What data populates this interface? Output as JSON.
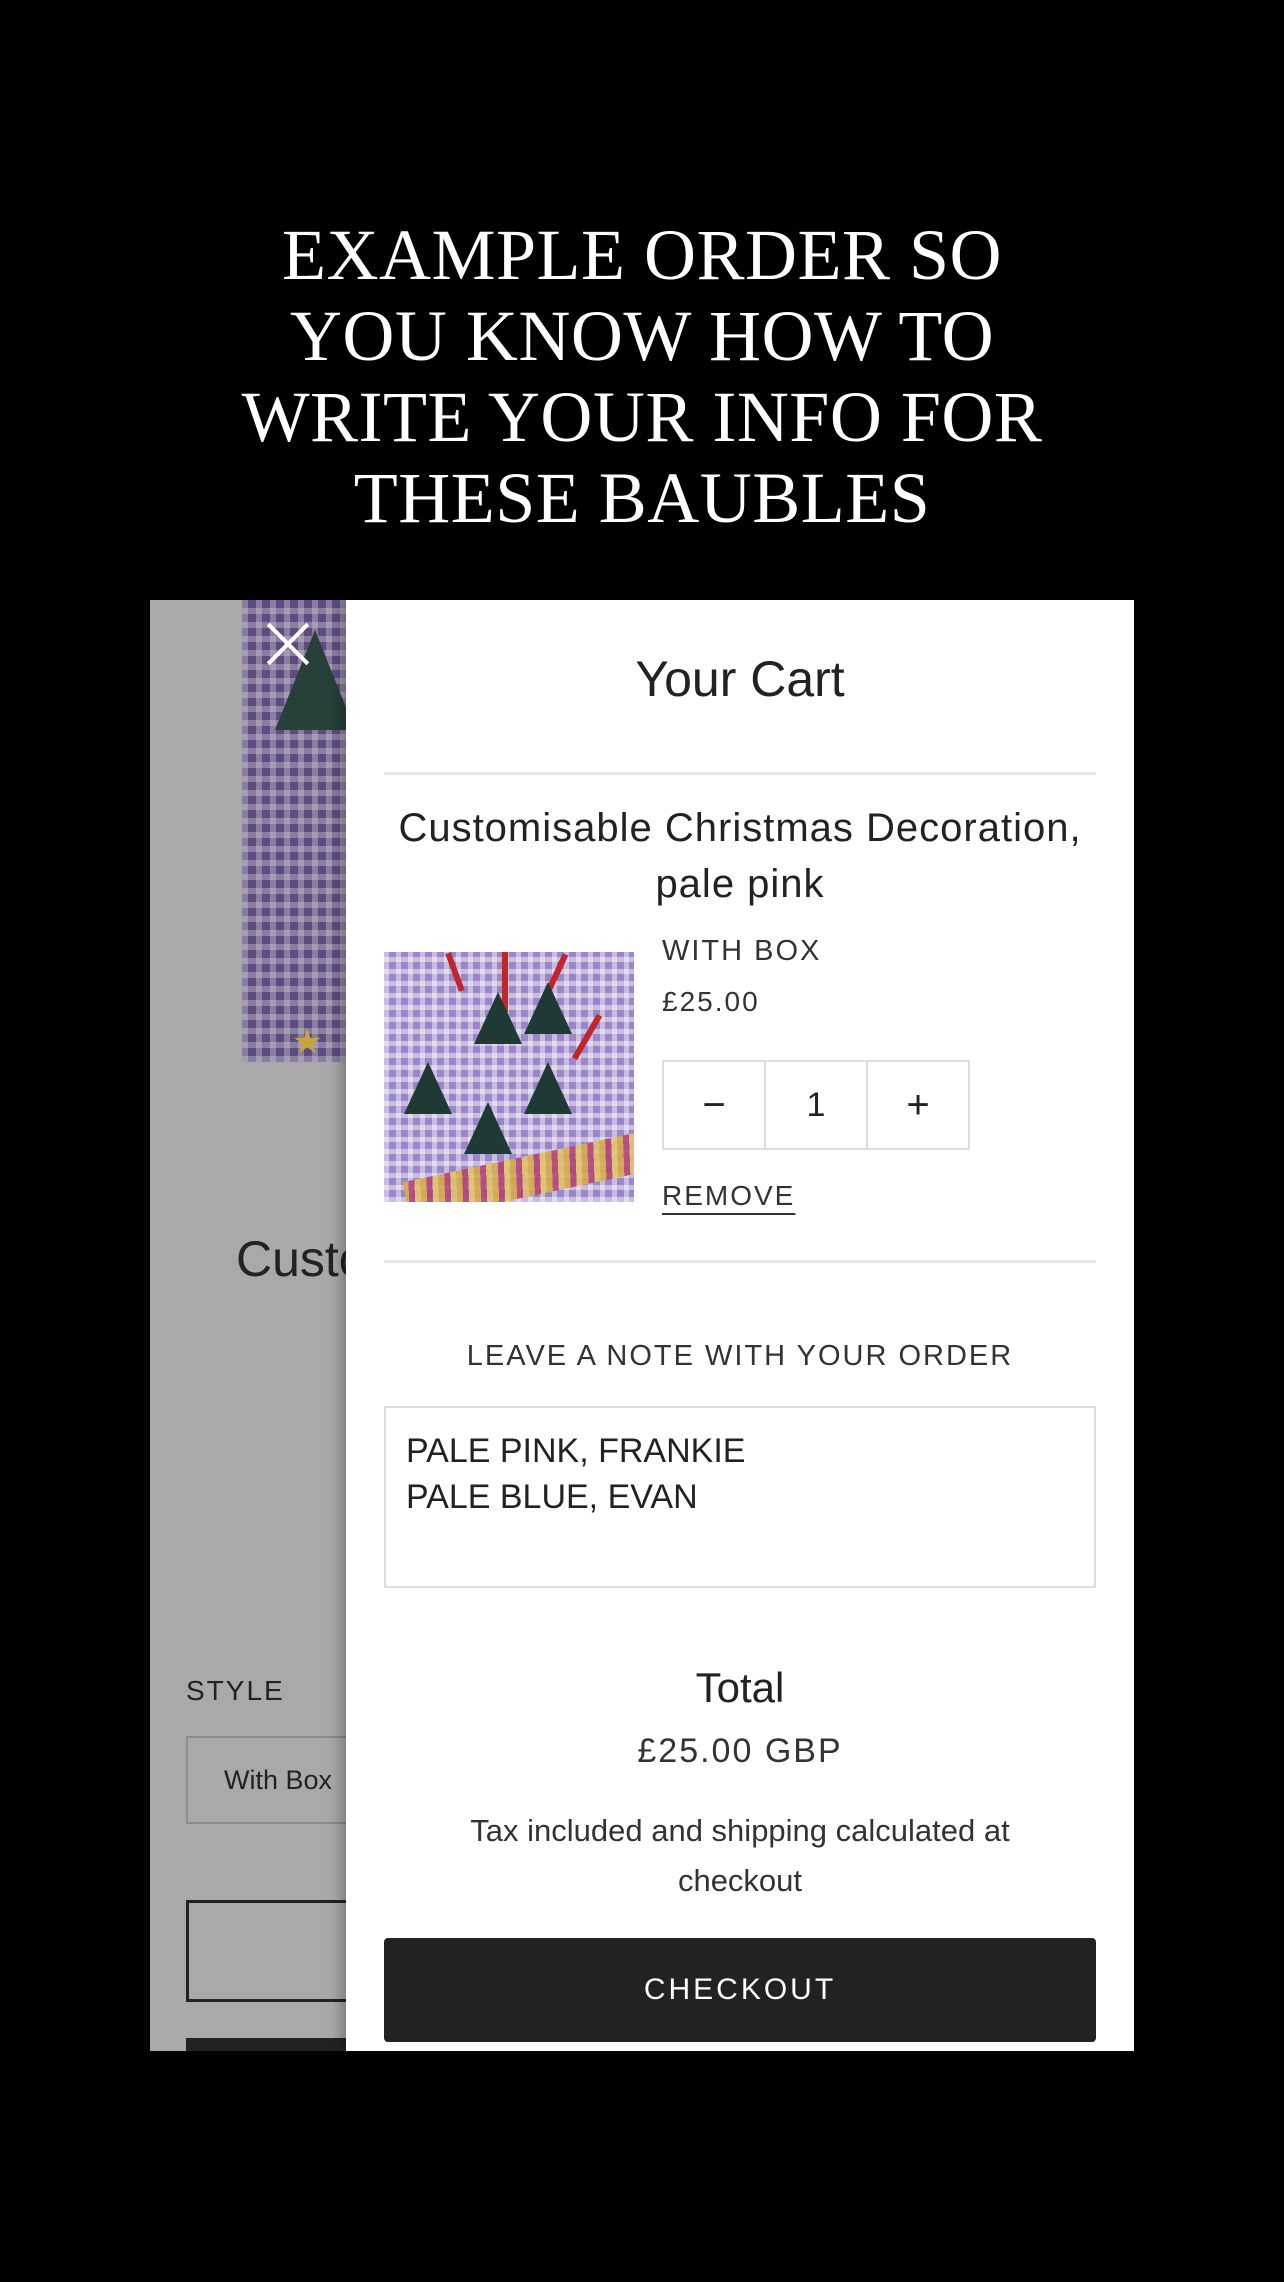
{
  "headline": {
    "lines": [
      "EXAMPLE ORDER SO",
      "YOU KNOW HOW TO",
      "WRITE YOUR INFO FOR",
      "THESE BAUBLES"
    ]
  },
  "background_page": {
    "title_partial": "Custo",
    "style_label": "STYLE",
    "style_select_value": "With Box"
  },
  "cart": {
    "title": "Your Cart",
    "item": {
      "title_line1": "Customisable Christmas Decoration,",
      "title_line2": "pale pink",
      "variant": "WITH BOX",
      "price": "£25.00",
      "quantity": "1",
      "decrement_symbol": "−",
      "increment_symbol": "+",
      "remove_label": "REMOVE"
    },
    "note": {
      "label": "LEAVE A NOTE WITH YOUR ORDER",
      "lines": [
        "PALE PINK, FRANKIE",
        "PALE BLUE, EVAN"
      ]
    },
    "total_label": "Total",
    "total_value": "£25.00 GBP",
    "tax_line1": "Tax included and shipping calculated at",
    "tax_line2": "checkout",
    "checkout_label": "CHECKOUT"
  }
}
